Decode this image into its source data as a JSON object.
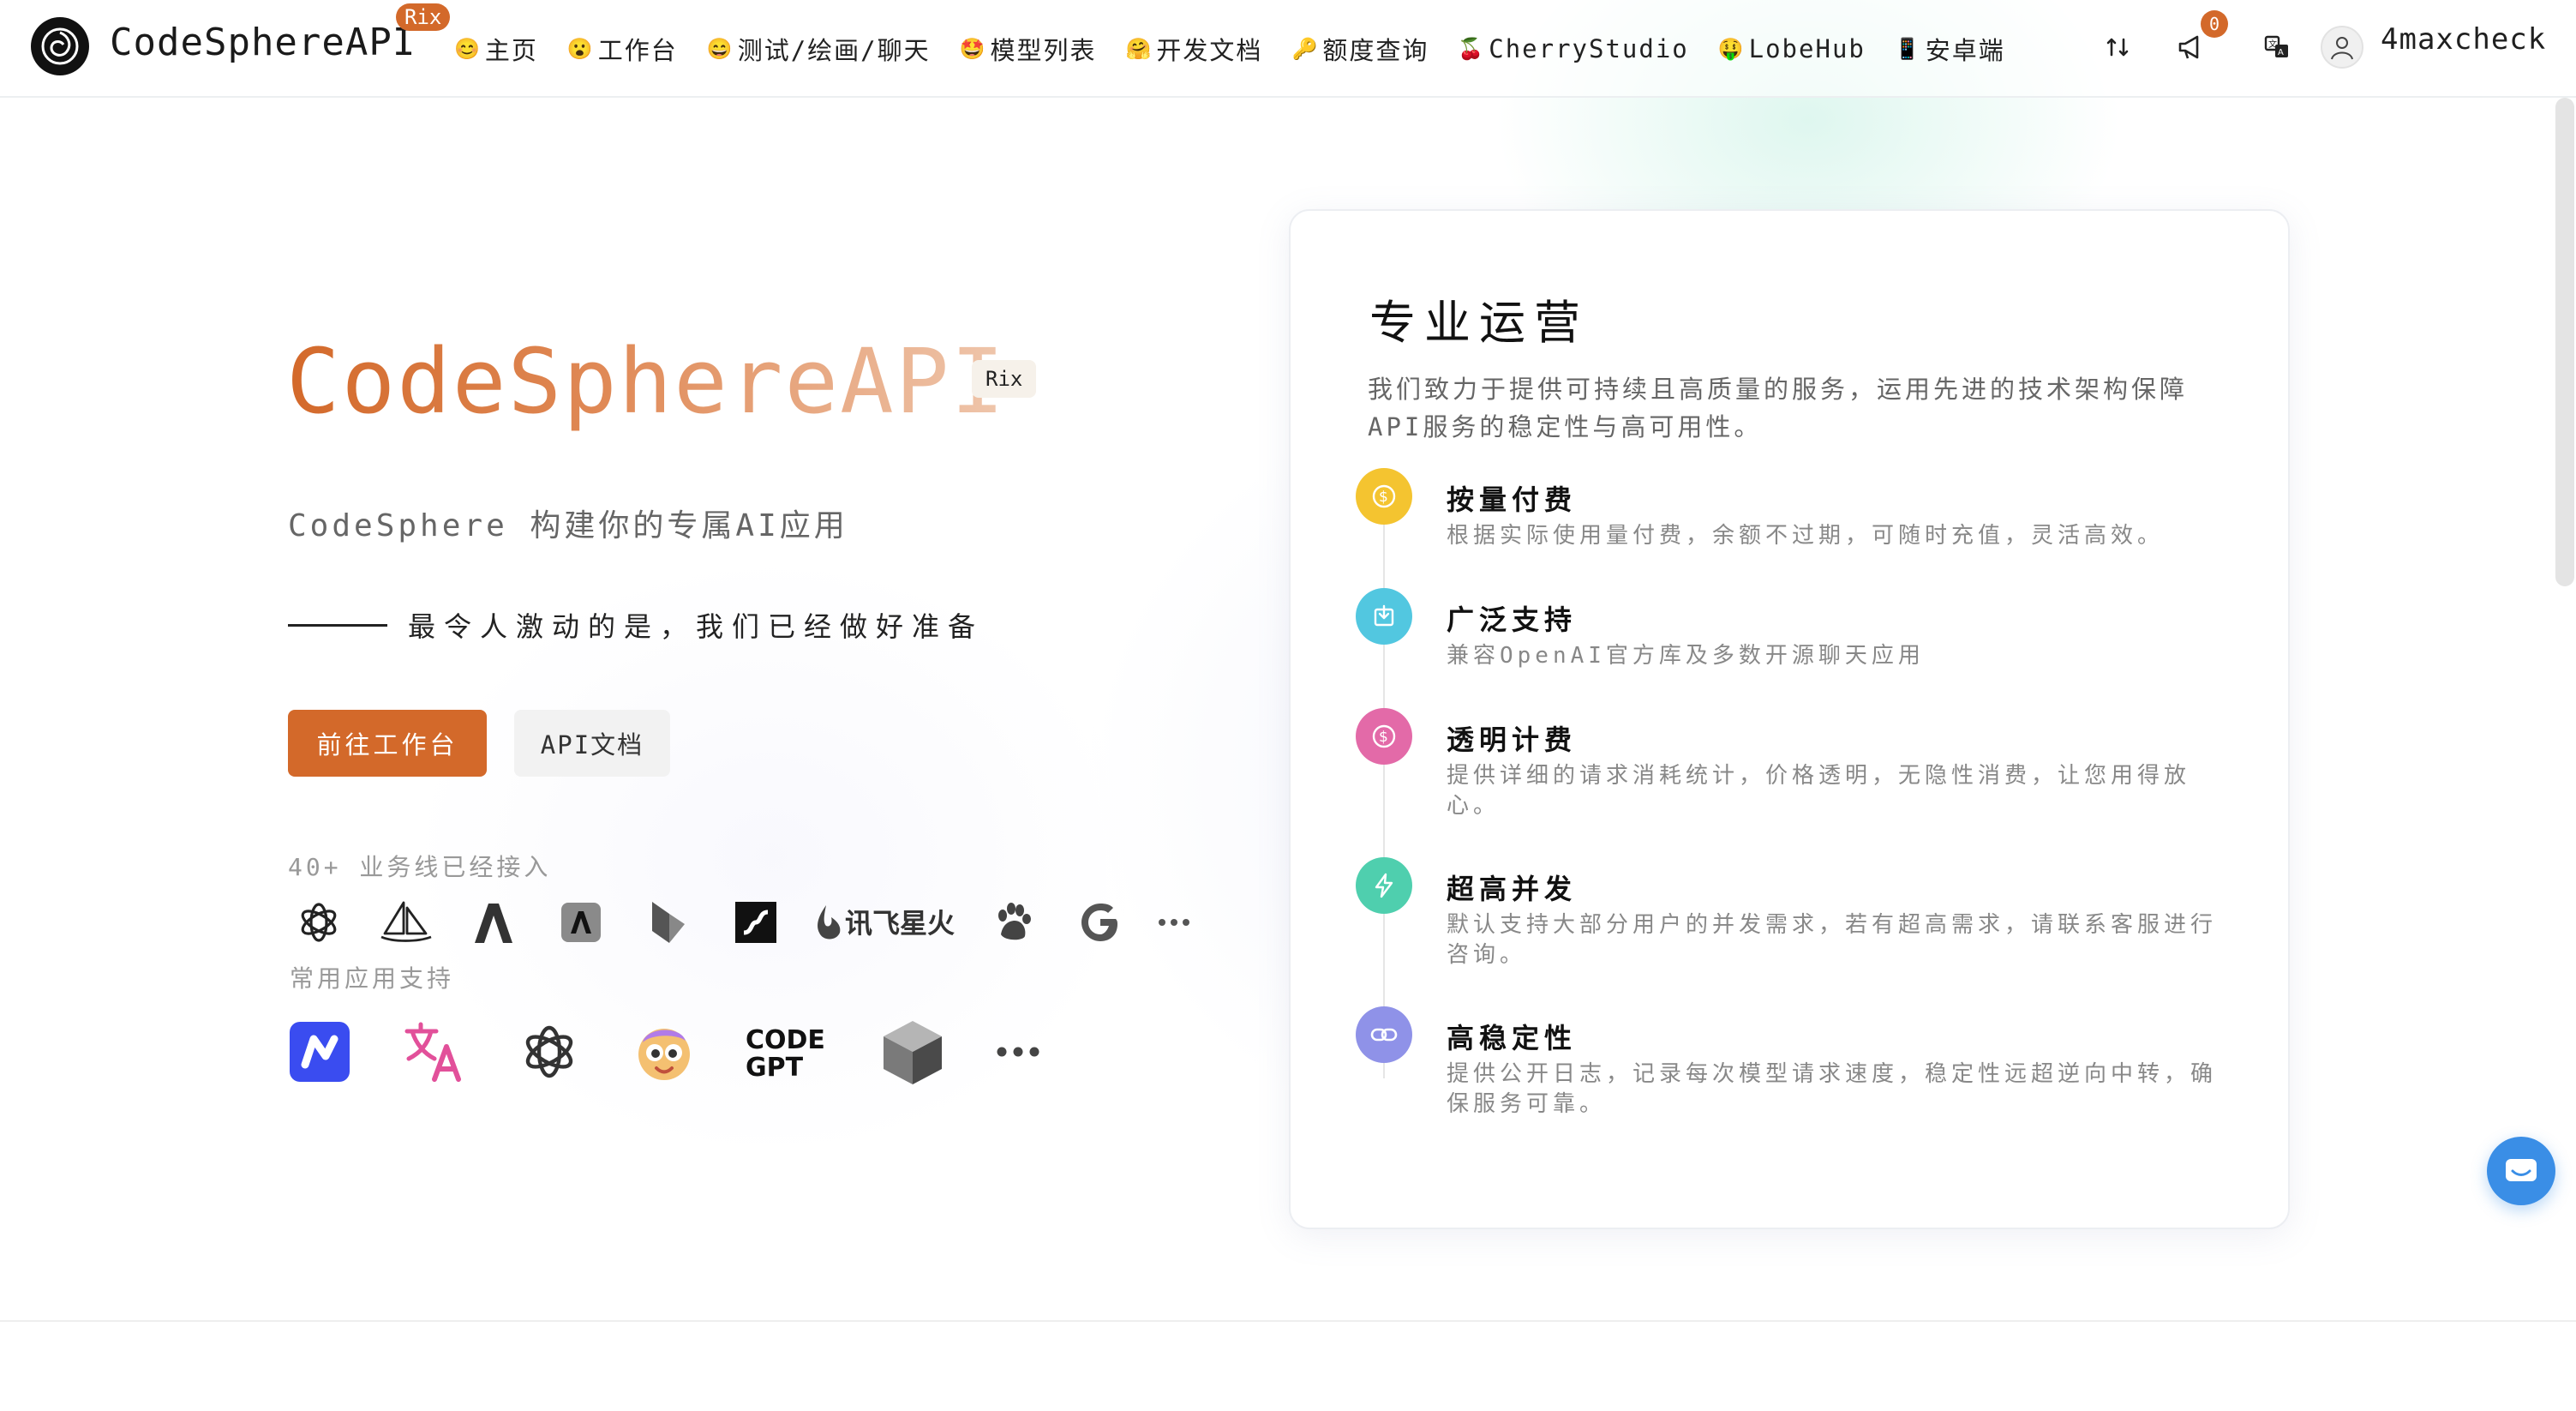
{
  "header": {
    "brand": "CodeSphereAPI",
    "brand_badge": "Rix",
    "nav": [
      {
        "emoji": "😊",
        "label": "主页"
      },
      {
        "emoji": "😮",
        "label": "工作台"
      },
      {
        "emoji": "😄",
        "label": "测试/绘画/聊天"
      },
      {
        "emoji": "🤩",
        "label": "模型列表"
      },
      {
        "emoji": "🤗",
        "label": "开发文档"
      },
      {
        "emoji": "🔑",
        "label": "额度查询"
      },
      {
        "emoji": "🍒",
        "label": "CherryStudio"
      },
      {
        "emoji": "🤑",
        "label": "LobeHub"
      },
      {
        "emoji": "📱",
        "label": "安卓端"
      }
    ],
    "notification_count": "0",
    "username": "4maxcheck"
  },
  "hero": {
    "title": "CodeSphereAPI",
    "badge": "Rix",
    "subtitle": "CodeSphere 构建你的专属AI应用",
    "tagline": "最令人激动的是，我们已经做好准备",
    "primary_button": "前往工作台",
    "secondary_button": "API文档",
    "business_label": "40+ 业务线已经接入",
    "apps_label": "常用应用支持",
    "provider_logos": [
      "openai-logo",
      "midjourney-logo",
      "anthropic-a-logo",
      "claude-logo",
      "bedrock-logo",
      "stability-logo",
      "xunfei-spark-logo",
      "baidu-paw-logo",
      "google-g-logo",
      "more-dots"
    ],
    "xunfei_text": "讯飞星火",
    "app_logos": [
      "nextchat-logo",
      "translate-logo",
      "openai-logo",
      "lobe-logo",
      "codegpt-logo",
      "cube-logo",
      "more-dots"
    ],
    "codegpt_text": [
      "CODE",
      "GPT"
    ]
  },
  "card": {
    "title": "专业运营",
    "description": "我们致力于提供可持续且高质量的服务，运用先进的技术架构保障API服务的稳定性与高可用性。",
    "items": [
      {
        "title": "按量付费",
        "text": "根据实际使用量付费，余额不过期，可随时充值，灵活高效。",
        "color": "#f4c430",
        "icon": "dollar-coin-icon"
      },
      {
        "title": "广泛支持",
        "text": "兼容OpenAI官方库及多数开源聊天应用",
        "color": "#52c7e0",
        "icon": "box-download-icon"
      },
      {
        "title": "透明计费",
        "text": "提供详细的请求消耗统计，价格透明，无隐性消费，让您用得放心。",
        "color": "#e36aa8",
        "icon": "dollar-circle-icon"
      },
      {
        "title": "超高并发",
        "text": "默认支持大部分用户的并发需求，若有超高需求，请联系客服进行咨询。",
        "color": "#4fcfae",
        "icon": "lightning-icon"
      },
      {
        "title": "高稳定性",
        "text": "提供公开日志，记录每次模型请求速度，稳定性远超逆向中转，确保服务可靠。",
        "color": "#8f92e8",
        "icon": "link-icon"
      }
    ]
  },
  "colors": {
    "accent": "#d3692a",
    "float_button": "#3a8ee6"
  }
}
